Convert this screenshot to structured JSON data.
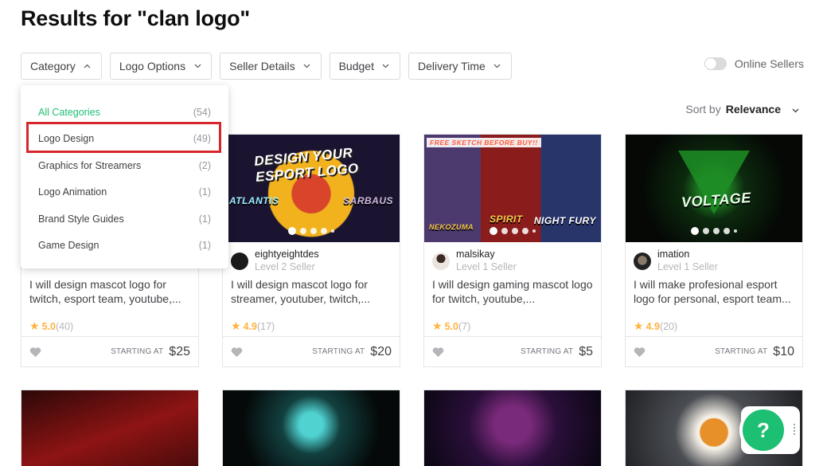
{
  "header": {
    "title": "Results for \"clan logo\""
  },
  "filters": [
    {
      "label": "Category",
      "expanded": true
    },
    {
      "label": "Logo Options",
      "expanded": false
    },
    {
      "label": "Seller Details",
      "expanded": false
    },
    {
      "label": "Budget",
      "expanded": false
    },
    {
      "label": "Delivery Time",
      "expanded": false
    }
  ],
  "online_sellers": {
    "label": "Online Sellers",
    "on": false
  },
  "sort": {
    "prefix": "Sort by",
    "value": "Relevance"
  },
  "category_dropdown": {
    "items": [
      {
        "name": "All Categories",
        "count": "(54)",
        "active": true
      },
      {
        "name": "Logo Design",
        "count": "(49)",
        "highlighted": true
      },
      {
        "name": "Graphics for Streamers",
        "count": "(2)"
      },
      {
        "name": "Logo Animation",
        "count": "(1)"
      },
      {
        "name": "Brand Style Guides",
        "count": "(1)"
      },
      {
        "name": "Game Design",
        "count": "(1)"
      }
    ]
  },
  "gigs": [
    {
      "seller": "",
      "level": "",
      "title": "I will design mascot logo for twitch, esport team, youtube,...",
      "rating": "5.0",
      "reviews": "(40)",
      "price_label": "STARTING AT",
      "price": "$25",
      "image_texts": []
    },
    {
      "seller": "eightyeightdes",
      "level": "Level 2 Seller",
      "title": "I will design mascot logo for streamer, youtuber, twitch,...",
      "rating": "4.9",
      "reviews": "(17)",
      "price_label": "STARTING AT",
      "price": "$20",
      "image_texts": [
        "DESIGN YOUR ESPORT LOGO",
        "ATLANTIS",
        "SARBAUS"
      ]
    },
    {
      "seller": "malsikay",
      "level": "Level 1 Seller",
      "title": "I will design gaming mascot logo for twitch, youtube,...",
      "rating": "5.0",
      "reviews": "(7)",
      "price_label": "STARTING AT",
      "price": "$5",
      "image_texts": [
        "FREE SKETCH BEFORE BUY!!",
        "NEKOZUMA",
        "SPIRIT",
        "NIGHT FURY"
      ]
    },
    {
      "seller": "imation",
      "level": "Level 1 Seller",
      "title": "I will make profesional esport logo for personal, esport team...",
      "rating": "4.9",
      "reviews": "(20)",
      "price_label": "STARTING AT",
      "price": "$10",
      "image_texts": [
        "VOLTAGE"
      ]
    }
  ],
  "help_button": {
    "label": "?"
  },
  "colors": {
    "accent": "#1dbf73",
    "star": "#ffb33e",
    "highlight": "#d7262b"
  }
}
